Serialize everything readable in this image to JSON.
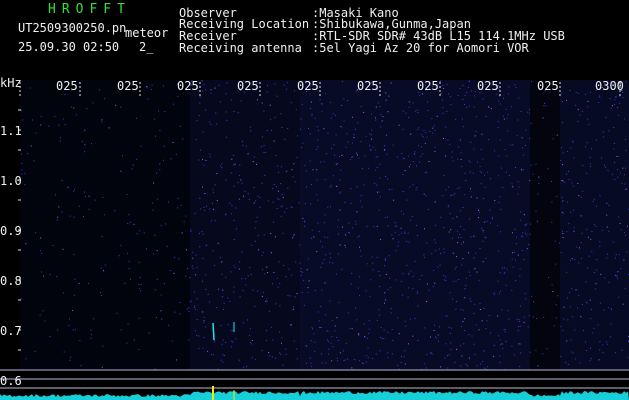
{
  "header": {
    "brand": "HROFFT",
    "filename": "UT2509300250.pn",
    "mode": "meteor",
    "datetime": "25.09.30 02:50",
    "index": "2_",
    "observer_label": "Observer",
    "observer_value": ":Masaki Kano",
    "location_label": "Receiving Location",
    "location_value": ":Shibukawa,Gunma,Japan",
    "receiver_label": "Receiver",
    "receiver_value": ":RTL-SDR SDR# 43dB L15 114.1MHz USB",
    "antenna_label": "Receiving antenna",
    "antenna_value": ":5el Yagi Az 20 for Aomori VOR"
  },
  "axis": {
    "unit": "kHz",
    "y_labels": [
      "1.1",
      "1.0",
      "0.9",
      "0.8",
      "0.7",
      "0.6"
    ],
    "x_labels": [
      "025",
      "025",
      "025",
      "025",
      "025",
      "025",
      "025",
      "025",
      "025",
      "0300"
    ]
  },
  "colors": {
    "background": "#000000",
    "noise": "#1e2fa0",
    "header_green": "#33e033",
    "text": "#f0f0f0",
    "signal_trace": "#18e6f0",
    "meteor_echo": "#f0f000"
  }
}
